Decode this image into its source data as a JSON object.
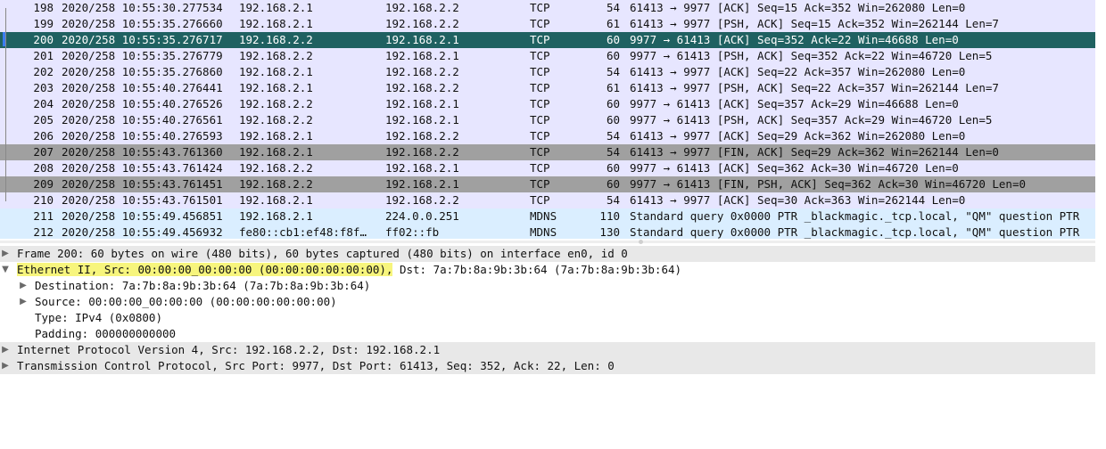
{
  "packet_list": {
    "rows": [
      {
        "no": "198",
        "time": "2020/258 10:55:30.277534",
        "src": "192.168.2.1",
        "dst": "192.168.2.2",
        "proto": "TCP",
        "len": "54",
        "info": "61413 → 9977 [ACK] Seq=15 Ack=352 Win=262080 Len=0",
        "style": "tcp"
      },
      {
        "no": "199",
        "time": "2020/258 10:55:35.276660",
        "src": "192.168.2.1",
        "dst": "192.168.2.2",
        "proto": "TCP",
        "len": "61",
        "info": "61413 → 9977 [PSH, ACK] Seq=15 Ack=352 Win=262144 Len=7",
        "style": "tcp"
      },
      {
        "no": "200",
        "time": "2020/258 10:55:35.276717",
        "src": "192.168.2.2",
        "dst": "192.168.2.1",
        "proto": "TCP",
        "len": "60",
        "info": "9977 → 61413 [ACK] Seq=352 Ack=22 Win=46688 Len=0",
        "style": "sel"
      },
      {
        "no": "201",
        "time": "2020/258 10:55:35.276779",
        "src": "192.168.2.2",
        "dst": "192.168.2.1",
        "proto": "TCP",
        "len": "60",
        "info": "9977 → 61413 [PSH, ACK] Seq=352 Ack=22 Win=46720 Len=5",
        "style": "tcp"
      },
      {
        "no": "202",
        "time": "2020/258 10:55:35.276860",
        "src": "192.168.2.1",
        "dst": "192.168.2.2",
        "proto": "TCP",
        "len": "54",
        "info": "61413 → 9977 [ACK] Seq=22 Ack=357 Win=262080 Len=0",
        "style": "tcp"
      },
      {
        "no": "203",
        "time": "2020/258 10:55:40.276441",
        "src": "192.168.2.1",
        "dst": "192.168.2.2",
        "proto": "TCP",
        "len": "61",
        "info": "61413 → 9977 [PSH, ACK] Seq=22 Ack=357 Win=262144 Len=7",
        "style": "tcp"
      },
      {
        "no": "204",
        "time": "2020/258 10:55:40.276526",
        "src": "192.168.2.2",
        "dst": "192.168.2.1",
        "proto": "TCP",
        "len": "60",
        "info": "9977 → 61413 [ACK] Seq=357 Ack=29 Win=46688 Len=0",
        "style": "tcp"
      },
      {
        "no": "205",
        "time": "2020/258 10:55:40.276561",
        "src": "192.168.2.2",
        "dst": "192.168.2.1",
        "proto": "TCP",
        "len": "60",
        "info": "9977 → 61413 [PSH, ACK] Seq=357 Ack=29 Win=46720 Len=5",
        "style": "tcp"
      },
      {
        "no": "206",
        "time": "2020/258 10:55:40.276593",
        "src": "192.168.2.1",
        "dst": "192.168.2.2",
        "proto": "TCP",
        "len": "54",
        "info": "61413 → 9977 [ACK] Seq=29 Ack=362 Win=262080 Len=0",
        "style": "tcp"
      },
      {
        "no": "207",
        "time": "2020/258 10:55:43.761360",
        "src": "192.168.2.1",
        "dst": "192.168.2.2",
        "proto": "TCP",
        "len": "54",
        "info": "61413 → 9977 [FIN, ACK] Seq=29 Ack=362 Win=262144 Len=0",
        "style": "fin"
      },
      {
        "no": "208",
        "time": "2020/258 10:55:43.761424",
        "src": "192.168.2.2",
        "dst": "192.168.2.1",
        "proto": "TCP",
        "len": "60",
        "info": "9977 → 61413 [ACK] Seq=362 Ack=30 Win=46720 Len=0",
        "style": "tcp"
      },
      {
        "no": "209",
        "time": "2020/258 10:55:43.761451",
        "src": "192.168.2.2",
        "dst": "192.168.2.1",
        "proto": "TCP",
        "len": "60",
        "info": "9977 → 61413 [FIN, PSH, ACK] Seq=362 Ack=30 Win=46720 Len=0",
        "style": "fin"
      },
      {
        "no": "210",
        "time": "2020/258 10:55:43.761501",
        "src": "192.168.2.1",
        "dst": "192.168.2.2",
        "proto": "TCP",
        "len": "54",
        "info": "61413 → 9977 [ACK] Seq=30 Ack=363 Win=262144 Len=0",
        "style": "tcp"
      },
      {
        "no": "211",
        "time": "2020/258 10:55:49.456851",
        "src": "192.168.2.1",
        "dst": "224.0.0.251",
        "proto": "MDNS",
        "len": "110",
        "info": "Standard query 0x0000 PTR _blackmagic._tcp.local, \"QM\" question PTR",
        "style": "mdns"
      },
      {
        "no": "212",
        "time": "2020/258 10:55:49.456932",
        "src": "fe80::cb1:ef48:f8f…",
        "dst": "ff02::fb",
        "proto": "MDNS",
        "len": "130",
        "info": "Standard query 0x0000 PTR _blackmagic._tcp.local, \"QM\" question PTR",
        "style": "mdns"
      }
    ]
  },
  "details": {
    "frame": "Frame 200: 60 bytes on wire (480 bits), 60 bytes captured (480 bits) on interface en0, id 0",
    "ethernet_highlighted": "Ethernet II, Src: 00:00:00_00:00:00 (00:00:00:00:00:00),",
    "ethernet_rest": " Dst: 7a:7b:8a:9b:3b:64 (7a:7b:8a:9b:3b:64)",
    "destination": "Destination: 7a:7b:8a:9b:3b:64 (7a:7b:8a:9b:3b:64)",
    "source": "Source: 00:00:00_00:00:00 (00:00:00:00:00:00)",
    "type": "Type: IPv4 (0x0800)",
    "padding": "Padding: 000000000000",
    "ip": "Internet Protocol Version 4, Src: 192.168.2.2, Dst: 192.168.2.1",
    "tcp": "Transmission Control Protocol, Src Port: 9977, Dst Port: 61413, Seq: 352, Ack: 22, Len: 0"
  },
  "icons": {
    "collapsed": "▶",
    "expanded": "▼"
  },
  "colors": {
    "tcp_row": "#e7e6ff",
    "mdns_row": "#daeeff",
    "fin_row": "#a0a0a0",
    "selected_row": "#1f6161",
    "highlight": "#f7f57d"
  }
}
